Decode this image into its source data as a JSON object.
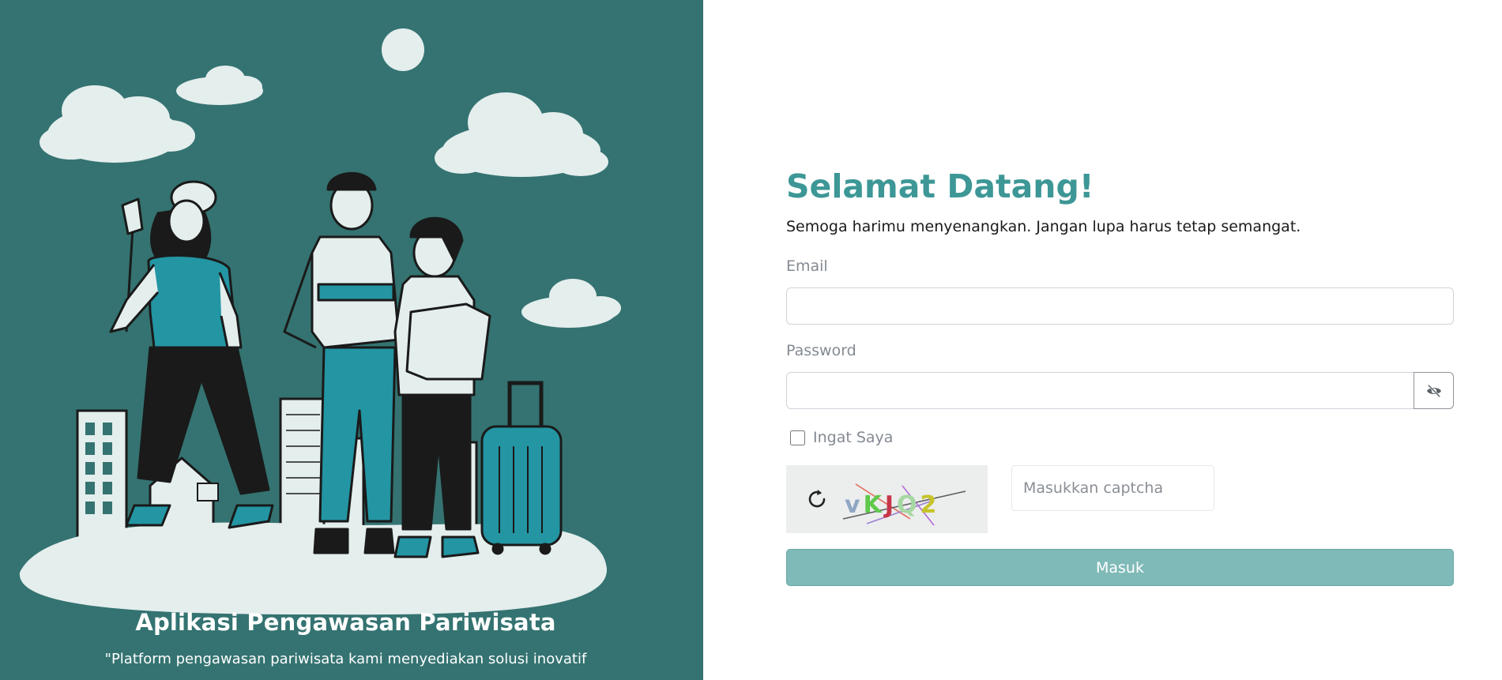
{
  "branding": {
    "app_title": "Aplikasi Pengawasan Pariwisata",
    "tagline": "\"Platform pengawasan pariwisata kami menyediakan solusi inovatif"
  },
  "login": {
    "heading": "Selamat Datang!",
    "subtitle": "Semoga harimu menyenangkan. Jangan lupa harus tetap semangat.",
    "email_label": "Email",
    "email_value": "",
    "password_label": "Password",
    "password_value": "",
    "remember_label": "Ingat Saya",
    "remember_checked": false,
    "captcha_text": "vKJQ2",
    "captcha_placeholder": "Masukkan captcha",
    "submit_label": "Masuk"
  },
  "icons": {
    "toggle_password": "eye-slash-icon",
    "captcha_refresh": "refresh-icon"
  },
  "colors": {
    "panel_bg": "#347371",
    "heading": "#3d9796",
    "button_bg": "#7fbab8",
    "illustration_light": "#e4eeed",
    "illustration_accent": "#2395a3"
  }
}
